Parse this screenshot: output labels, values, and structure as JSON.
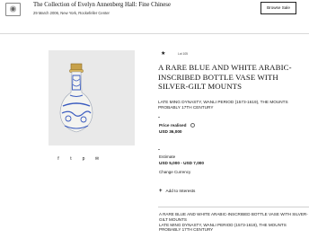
{
  "header": {
    "sale_title": "The Collection of Evelyn Annenberg Hall: Fine Chinese",
    "sale_subtitle": "29 March 2006, New York, Rockefeller Center",
    "browse_button": "Browse Sale"
  },
  "share": {
    "icons": [
      "facebook-icon",
      "twitter-icon",
      "pinterest-icon",
      "email-icon"
    ],
    "glyphs": [
      "f",
      "t",
      "p",
      "✉"
    ]
  },
  "lot": {
    "lot_label": "Lot 105",
    "title": "A RARE BLUE AND WHITE ARABIC-INSCRIBED BOTTLE VASE WITH SILVER-GILT MOUNTS",
    "subtitle": "LATE MING DYNASTY, WANLI PERIOD (1573-1619), THE MOUNTS PROBABLY 17TH CENTURY",
    "price_label": "Price realised",
    "price_value": "USD 36,000",
    "estimate_label": "Estimate",
    "estimate_value": "USD 5,000 - USD 7,000",
    "change_currency": "Change Currency",
    "add_interests": "Add to Interests",
    "description_line1": "A RARE BLUE AND WHITE ARABIC-INSCRIBED BOTTLE VASE WITH SILVER-GILT MOUNTS",
    "description_line2": "LATE MING DYNASTY, WANLI PERIOD (1573-1619), THE MOUNTS PROBABLY 17TH CENTURY"
  },
  "colors": {
    "image_background": "#e9e9e9",
    "porcelain_blue": "#3a5bbf",
    "gilt": "#c7a14a"
  }
}
